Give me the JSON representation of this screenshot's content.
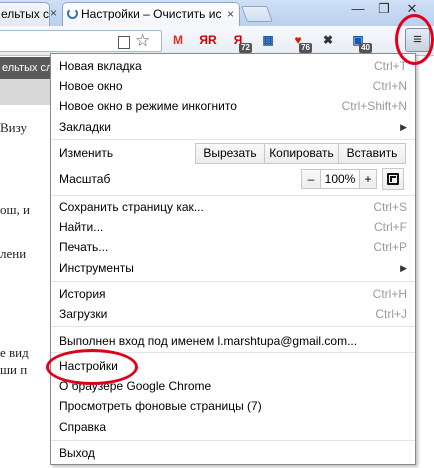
{
  "tabs": {
    "left_tab_title": "ельтых сло",
    "active_tab_title": "Настройки – Очистить ис",
    "close_glyph": "×"
  },
  "window_controls": {
    "minimize": "—",
    "restore": "❐",
    "close": "✕"
  },
  "extensions": [
    {
      "icon": "gmail-icon",
      "glyph": "M",
      "color": "#d93025",
      "badge": ""
    },
    {
      "icon": "yandex-icon",
      "glyph": "ЯR",
      "color": "#cc0000",
      "badge": ""
    },
    {
      "icon": "yandex-mail-icon",
      "glyph": "Я",
      "color": "#cc0000",
      "badge": "72"
    },
    {
      "icon": "translate-flag-icon",
      "glyph": "▦",
      "color": "#2255aa",
      "badge": ""
    },
    {
      "icon": "bookmark-extension-icon",
      "glyph": "♥",
      "color": "#cc2200",
      "badge": "76"
    },
    {
      "icon": "blocker-icon",
      "glyph": "✖",
      "color": "#333333",
      "badge": ""
    },
    {
      "icon": "downloader-icon",
      "glyph": "▣",
      "color": "#1a56b0",
      "badge": "40"
    }
  ],
  "page_fragments": {
    "strip": "ельтых сл",
    "line1": "Визу",
    "line2": "ош, и",
    "line3": "лени",
    "line4": "е вид",
    "line5": "ши п"
  },
  "menu": {
    "items": [
      {
        "label": "Новая вкладка",
        "shortcut": "Ctrl+T"
      },
      {
        "label": "Новое окно",
        "shortcut": "Ctrl+N"
      },
      {
        "label": "Новое окно в режиме инкогнито",
        "shortcut": "Ctrl+Shift+N"
      },
      {
        "label": "Закладки",
        "shortcut": ""
      },
      {
        "label": "Изменить",
        "shortcut": ""
      },
      {
        "label": "Масштаб",
        "shortcut": ""
      },
      {
        "label": "Сохранить страницу как...",
        "shortcut": "Ctrl+S"
      },
      {
        "label": "Найти...",
        "shortcut": "Ctrl+F"
      },
      {
        "label": "Печать...",
        "shortcut": "Ctrl+P"
      },
      {
        "label": "Инструменты",
        "shortcut": ""
      },
      {
        "label": "История",
        "shortcut": "Ctrl+H"
      },
      {
        "label": "Загрузки",
        "shortcut": "Ctrl+J"
      },
      {
        "label": "Выполнен вход под именем l.marshtupa@gmail.com...",
        "shortcut": ""
      },
      {
        "label": "Настройки",
        "shortcut": ""
      },
      {
        "label": "О браузере Google Chrome",
        "shortcut": ""
      },
      {
        "label": "Просмотреть фоновые страницы (7)",
        "shortcut": ""
      },
      {
        "label": "Справка",
        "shortcut": ""
      },
      {
        "label": "Выход",
        "shortcut": ""
      }
    ],
    "submenu_arrow": "▶",
    "edit_buttons": {
      "cut": "Вырезать",
      "copy": "Копировать",
      "paste": "Вставить"
    },
    "zoom": {
      "minus": "–",
      "value": "100%",
      "plus": "+"
    }
  },
  "highlight_color": "#e0001b"
}
